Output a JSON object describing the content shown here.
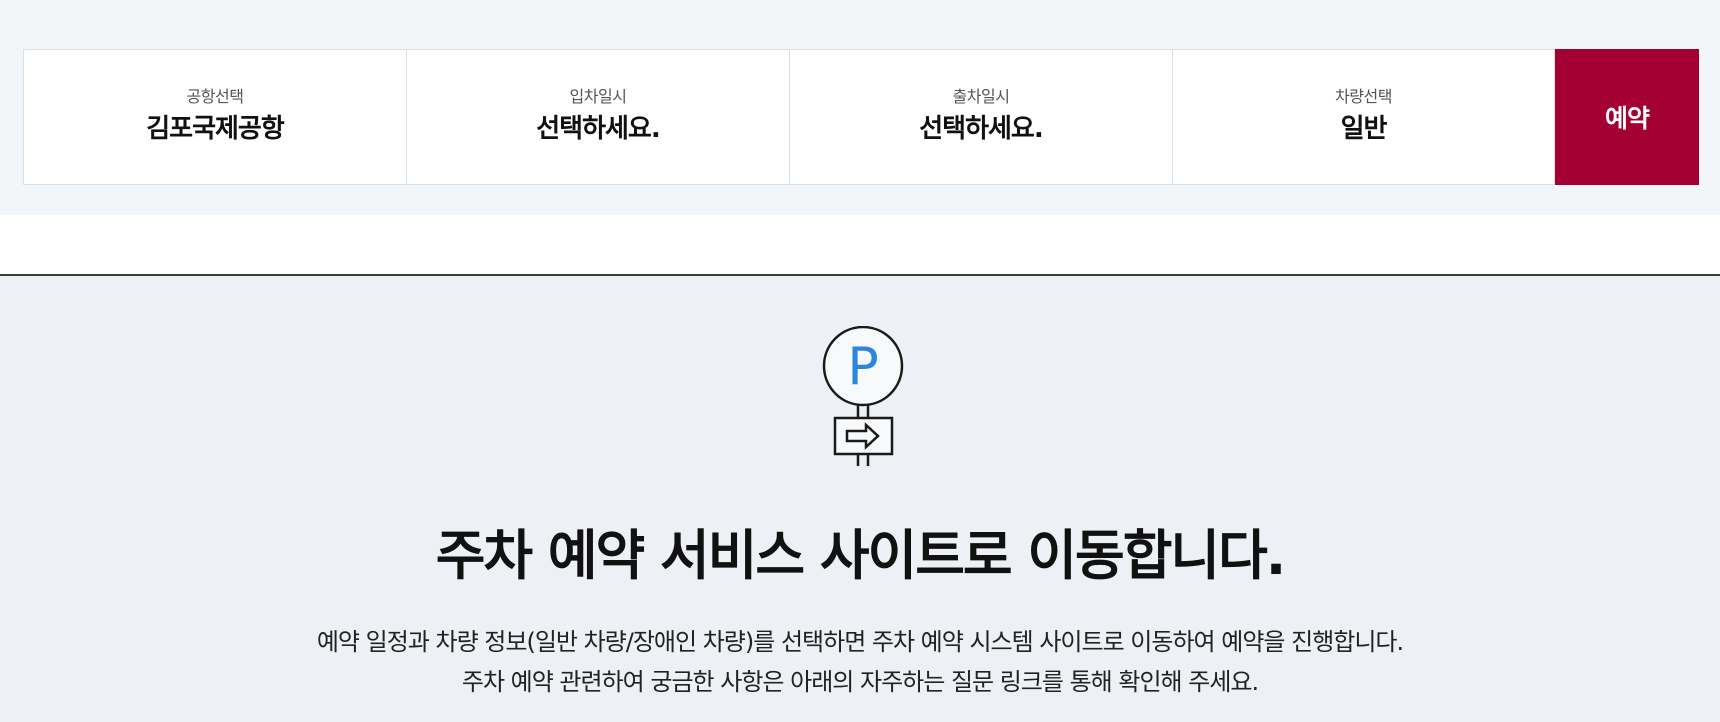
{
  "search_bar": {
    "airport": {
      "label": "공항선택",
      "value": "김포국제공항"
    },
    "entry": {
      "label": "입차일시",
      "value": "선택하세요."
    },
    "exit": {
      "label": "출차일시",
      "value": "선택하세요."
    },
    "vehicle": {
      "label": "차량선택",
      "value": "일반"
    },
    "reserve_label": "예약",
    "accent_color": "#a50034"
  },
  "notice": {
    "icon": "parking-sign-icon",
    "icon_letter": "P",
    "headline": "주차 예약 서비스 사이트로 이동합니다.",
    "description_lines": [
      "예약 일정과 차량 정보(일반 차량/장애인 차량)를 선택하면 주차 예약 시스템 사이트로 이동하여 예약을 진행합니다.",
      "주차 예약 관련하여 궁금한 사항은 아래의 자주하는 질문 링크를 통해 확인해 주세요."
    ],
    "icon_color": "#2b86d9"
  }
}
